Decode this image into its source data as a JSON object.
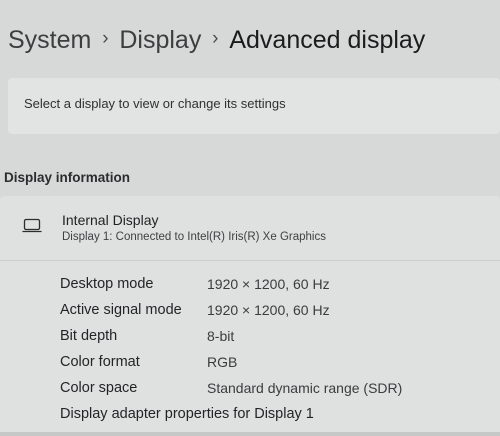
{
  "breadcrumb": {
    "items": [
      "System",
      "Display",
      "Advanced display"
    ],
    "separator": "›"
  },
  "select_display": {
    "label": "Select a display to view or change its settings"
  },
  "display_information": {
    "title": "Display information",
    "display": {
      "icon": "monitor-icon",
      "name": "Internal Display",
      "description": "Display 1: Connected to Intel(R) Iris(R) Xe Graphics"
    },
    "properties": [
      {
        "label": "Desktop mode",
        "value": "1920 × 1200, 60 Hz"
      },
      {
        "label": "Active signal mode",
        "value": "1920 × 1200, 60 Hz"
      },
      {
        "label": "Bit depth",
        "value": "8-bit"
      },
      {
        "label": "Color format",
        "value": "RGB"
      },
      {
        "label": "Color space",
        "value": "Standard dynamic range (SDR)"
      }
    ],
    "adapter_link": "Display adapter properties for Display 1"
  },
  "colors": {
    "background": "#d7d9d8",
    "card": "#e2e4e3",
    "text": "#1e1f21"
  }
}
